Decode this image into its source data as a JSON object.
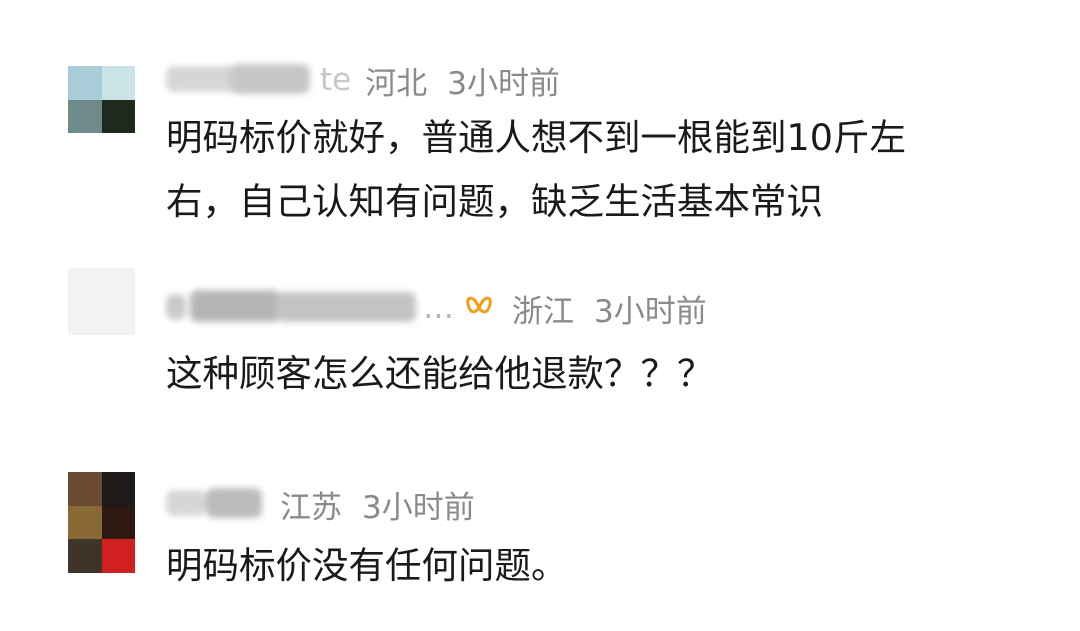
{
  "comments": [
    {
      "username_partial": "te",
      "location": "河北",
      "time": "3小时前",
      "lines": [
        "明码标价就好，普通人想不到一根能到10斤左",
        "右，自己认知有问题，缺乏生活基本常识"
      ],
      "avatar_colors": [
        "#a8ccd8",
        "#c9e3e6",
        "#6f8a8a",
        "#1d2a1c"
      ]
    },
    {
      "username_partial": "…",
      "badge_icon": "butterfly-icon",
      "location": "浙江",
      "time": "3小时前",
      "lines": [
        "这种顾客怎么还能给他退款？？？"
      ],
      "avatar_colors": [
        "#f2f2f2",
        "#f2f2f2",
        "#f2f2f2",
        "#f2f2f2"
      ]
    },
    {
      "location": "江苏",
      "time": "3小时前",
      "lines": [
        "明码标价没有任何问题。"
      ],
      "avatar_colors": [
        "#6b4a32",
        "#1e1a1a",
        "#8a6a34",
        "#2c1a12",
        "#3e3428",
        "#d02020"
      ]
    }
  ],
  "colors": {
    "meta_text": "#8a8a8a",
    "body_text": "#1a1a1a",
    "badge": "#f0a020"
  }
}
